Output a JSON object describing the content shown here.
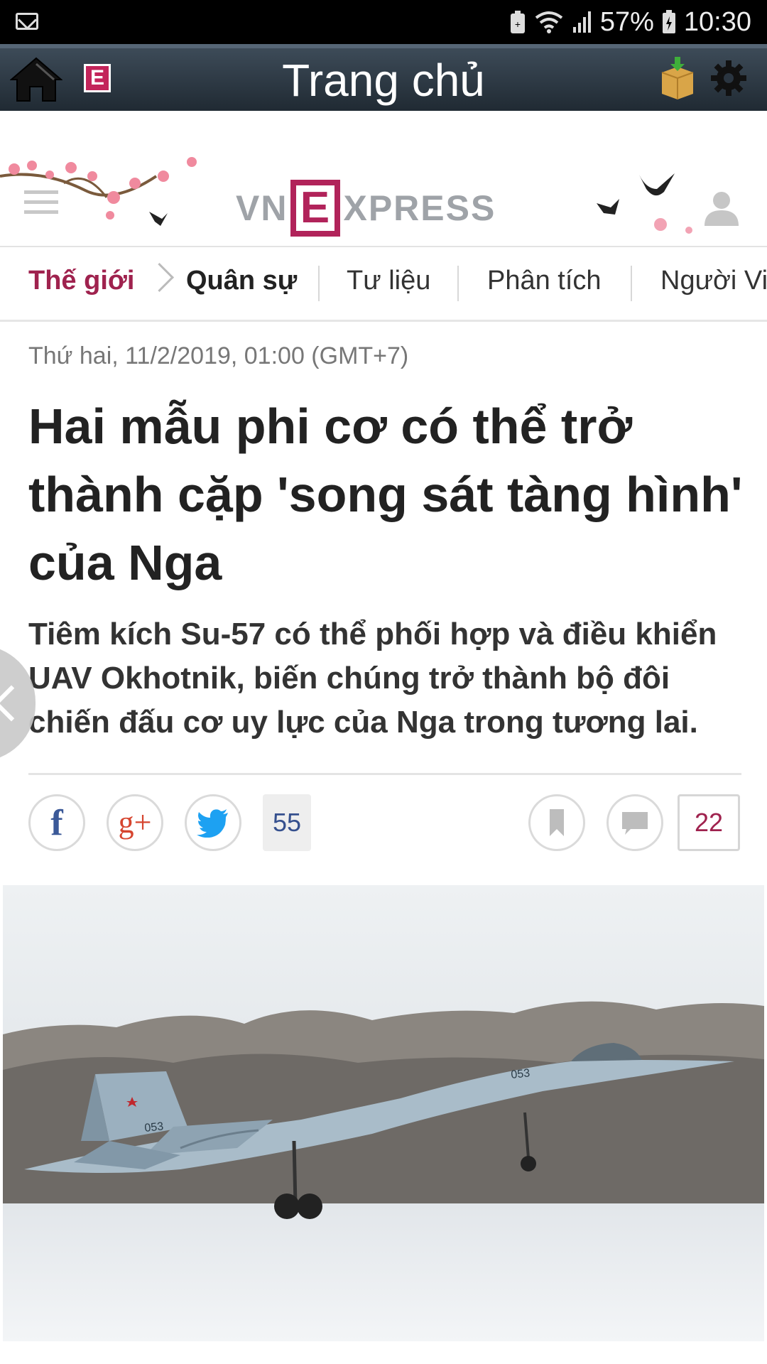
{
  "status_bar": {
    "battery_percent": "57%",
    "time": "10:30"
  },
  "app_bar": {
    "title": "Trang chủ",
    "badge_letter": "E"
  },
  "brand": {
    "left": "VN",
    "middle": "E",
    "right": "XPRESS",
    "accent": "#b1235a"
  },
  "breadcrumb": {
    "section": "Thế giới",
    "current": "Quân sự",
    "tabs": [
      "Tư liệu",
      "Phân tích",
      "Người Vi"
    ]
  },
  "article": {
    "date": "Thứ hai, 11/2/2019, 01:00 (GMT+7)",
    "title": "Hai mẫu phi cơ có thể trở thành cặp 'song sát tàng hình' của Nga",
    "lead": "Tiêm kích Su-57 có thể phối hợp và điều khiển UAV Okhotnik, biến chúng trở thành bộ đôi chiến đấu cơ uy lực của Nga trong tương lai."
  },
  "share": {
    "facebook": "f",
    "google_plus": "g+",
    "share_count": "55",
    "comment_count": "22"
  },
  "photo": {
    "tail_number": "053",
    "tail_number_fin": "053"
  }
}
